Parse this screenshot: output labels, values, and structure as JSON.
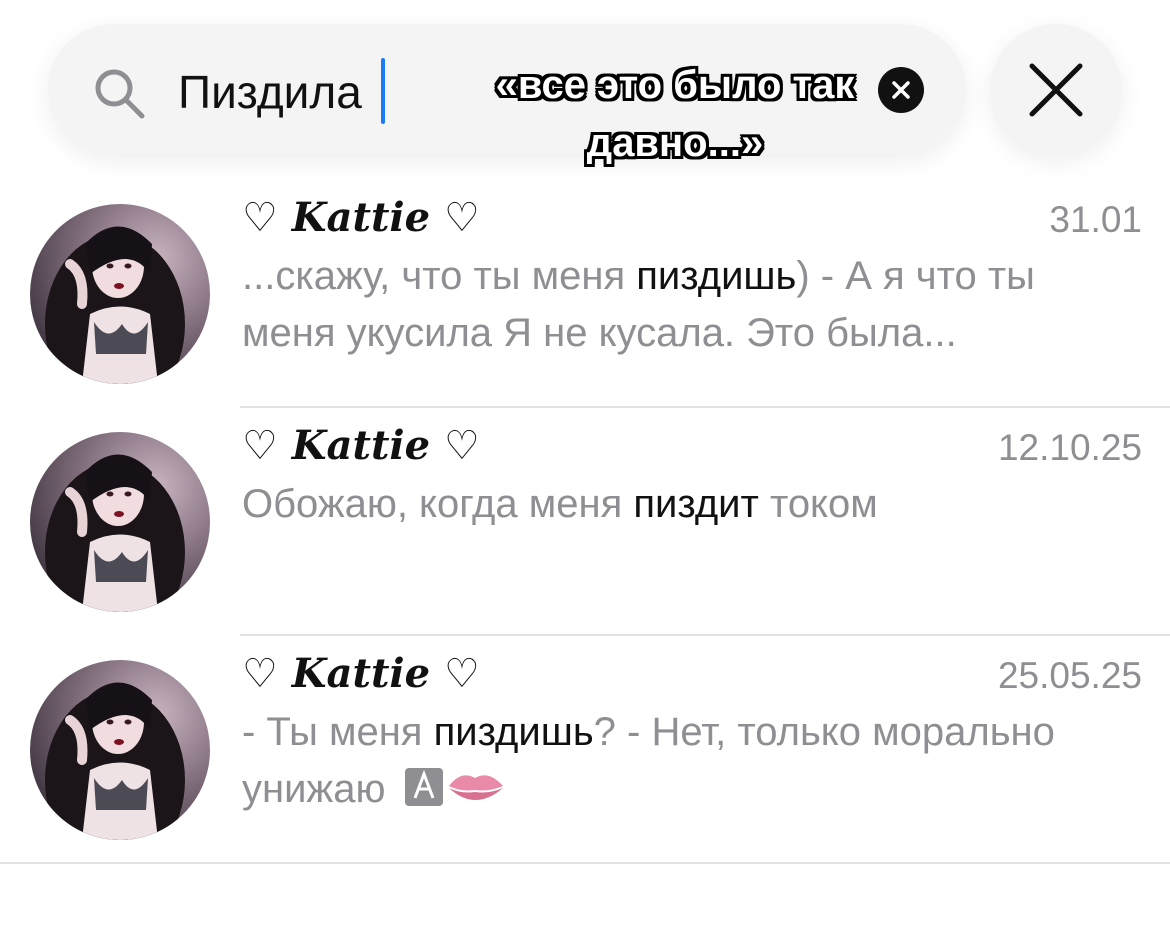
{
  "search": {
    "query": "Пиздила",
    "overlay_caption": "«все это было так давно...»"
  },
  "messages": [
    {
      "name": "♡ Kattie ♡",
      "date": "31.01",
      "before": "...скажу, что ты меня ",
      "match": "пиздишь",
      "after": ") - А я что ты меня укусила Я не кусала. Это была..."
    },
    {
      "name": "♡ Kattie ♡",
      "date": "12.10.25",
      "before": "Обожаю, когда меня ",
      "match": "пиздит",
      "after": " током"
    },
    {
      "name": "♡ Kattie ♡",
      "date": "25.05.25",
      "before": "- Ты меня ",
      "match": "пиздишь",
      "after": "? - Нет, только морально унижаю "
    }
  ],
  "colors": {
    "caret": "#1a7cf5",
    "secondary_text": "#8e8e93",
    "primary_text": "#111111",
    "search_bg": "#f4f4f5"
  },
  "icons": [
    "search-icon",
    "clear-icon",
    "close-icon",
    "kiss-lips-icon",
    "avatar-image"
  ]
}
